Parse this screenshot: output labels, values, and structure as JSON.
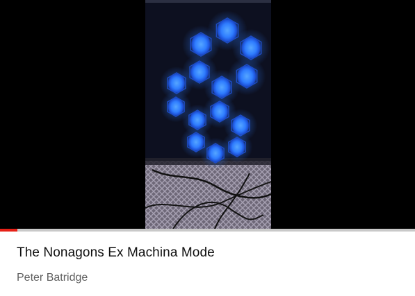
{
  "video": {
    "title": "The Nonagons Ex Machina Mode",
    "channel": "Peter Batridge",
    "progress_fraction": 0.042,
    "progress_color": "#e62117"
  },
  "video_frame": {
    "scene": "backlit-hexagon-light-panels",
    "glow_color": "#2f7dff"
  }
}
